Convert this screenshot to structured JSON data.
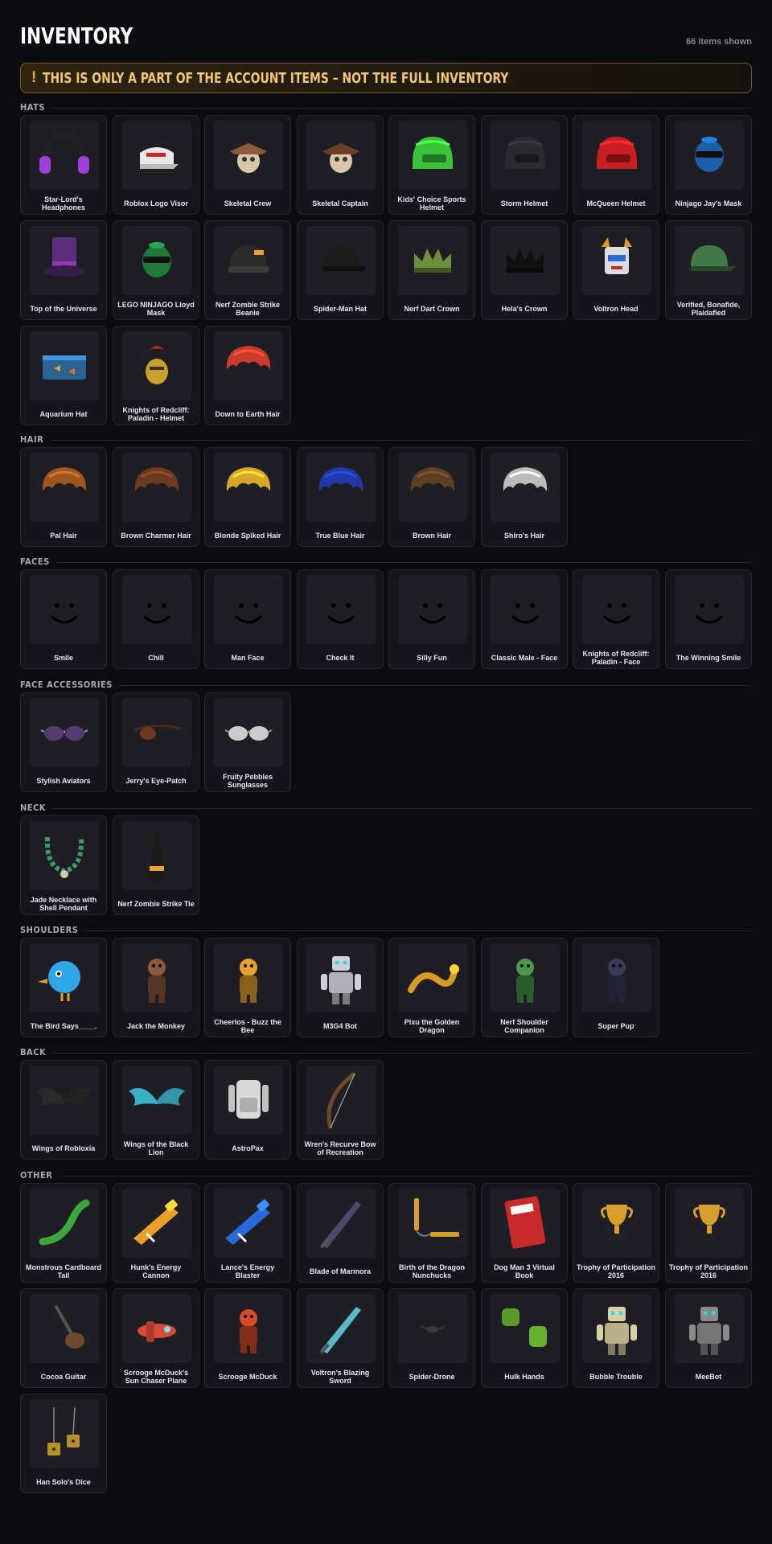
{
  "header": {
    "title": "INVENTORY",
    "count": "66 items shown"
  },
  "warning": {
    "icon": "!",
    "text": "THIS IS ONLY A PART OF THE ACCOUNT ITEMS – NOT THE FULL INVENTORY"
  },
  "colors": {
    "accent": "#f0a92e",
    "warning_text": "#f3c575",
    "background": "#0b0b10",
    "card": "#15151b"
  },
  "sections": [
    {
      "label": "HATS",
      "items": [
        {
          "name": "Star-Lord's Headphones",
          "icon": "headphones-icon",
          "color": "#9b3fd6"
        },
        {
          "name": "Roblox Logo Visor",
          "icon": "visor-icon",
          "color": "#e8e8e8"
        },
        {
          "name": "Skeletal Crew",
          "icon": "skull-hat-icon",
          "color": "#8a5a3a"
        },
        {
          "name": "Skeletal Captain",
          "icon": "skull-hat-icon",
          "color": "#6b3f25"
        },
        {
          "name": "Kids' Choice Sports Helmet",
          "icon": "helmet-icon",
          "color": "#39c23a"
        },
        {
          "name": "Storm Helmet",
          "icon": "helmet-icon",
          "color": "#2a2a30"
        },
        {
          "name": "McQueen Helmet",
          "icon": "helmet-icon",
          "color": "#c81e22"
        },
        {
          "name": "Ninjago Jay's Mask",
          "icon": "mask-icon",
          "color": "#1d5ea8"
        },
        {
          "name": "Top of the Universe",
          "icon": "top-hat-icon",
          "color": "#5a2e7a"
        },
        {
          "name": "LEGO NINJAGO Lloyd Mask",
          "icon": "mask-icon",
          "color": "#1f7a3a"
        },
        {
          "name": "Nerf Zombie Strike Beanie",
          "icon": "beanie-icon",
          "color": "#2a2a2a"
        },
        {
          "name": "Spider-Man Hat",
          "icon": "cap-icon",
          "color": "#1c1c1c"
        },
        {
          "name": "Nerf Dart Crown",
          "icon": "crown-icon",
          "color": "#6b8f3a"
        },
        {
          "name": "Hela's Crown",
          "icon": "crown-icon",
          "color": "#111111"
        },
        {
          "name": "Voltron Head",
          "icon": "robot-head-icon",
          "color": "#dddddd"
        },
        {
          "name": "Verified, Bonafide, Plaidafied",
          "icon": "cap-icon",
          "color": "#3f7a48"
        },
        {
          "name": "Aquarium Hat",
          "icon": "aquarium-icon",
          "color": "#2d6fa5"
        },
        {
          "name": "Knights of Redcliff: Paladin - Helmet",
          "icon": "knight-helmet-icon",
          "color": "#b12a22"
        },
        {
          "name": "Down to Earth Hair",
          "icon": "hair-icon",
          "color": "#c93b2b"
        }
      ]
    },
    {
      "label": "HAIR",
      "items": [
        {
          "name": "Pal Hair",
          "icon": "hair-icon",
          "color": "#a0561f"
        },
        {
          "name": "Brown Charmer Hair",
          "icon": "hair-icon",
          "color": "#6b3a1f"
        },
        {
          "name": "Blonde Spiked Hair",
          "icon": "hair-icon",
          "color": "#d6a82a"
        },
        {
          "name": "True Blue Hair",
          "icon": "hair-icon",
          "color": "#1f3aa6"
        },
        {
          "name": "Brown Hair",
          "icon": "hair-icon",
          "color": "#5e3e24"
        },
        {
          "name": "Shiro's Hair",
          "icon": "hair-icon",
          "color": "#bbbbbb"
        }
      ]
    },
    {
      "label": "FACES",
      "items": [
        {
          "name": "Smile",
          "icon": "face-icon",
          "color": "#111111"
        },
        {
          "name": "Chill",
          "icon": "face-icon",
          "color": "#111111"
        },
        {
          "name": "Man Face",
          "icon": "face-icon",
          "color": "#111111"
        },
        {
          "name": "Check It",
          "icon": "face-icon",
          "color": "#111111"
        },
        {
          "name": "Silly Fun",
          "icon": "face-icon",
          "color": "#111111"
        },
        {
          "name": "Classic Male - Face",
          "icon": "face-icon",
          "color": "#111111"
        },
        {
          "name": "Knights of Redcliff: Paladin - Face",
          "icon": "face-icon",
          "color": "#111111"
        },
        {
          "name": "The Winning Smile",
          "icon": "face-icon",
          "color": "#111111"
        }
      ]
    },
    {
      "label": "FACE ACCESSORIES",
      "items": [
        {
          "name": "Stylish Aviators",
          "icon": "glasses-icon",
          "color": "#5a3a6e"
        },
        {
          "name": "Jerry's Eye-Patch",
          "icon": "eye-patch-icon",
          "color": "#6b3a1f"
        },
        {
          "name": "Fruity Pebbles Sunglasses",
          "icon": "glasses-icon",
          "color": "#cccccc"
        }
      ]
    },
    {
      "label": "NECK",
      "items": [
        {
          "name": "Jade Necklace with Shell Pendant",
          "icon": "necklace-icon",
          "color": "#3a9a6a"
        },
        {
          "name": "Nerf Zombie Strike Tie",
          "icon": "tie-icon",
          "color": "#1a1a1a"
        }
      ]
    },
    {
      "label": "SHOULDERS",
      "items": [
        {
          "name": "The Bird Says____.",
          "icon": "bird-icon",
          "color": "#2ea6e8"
        },
        {
          "name": "Jack the Monkey",
          "icon": "monkey-icon",
          "color": "#8a5a3a"
        },
        {
          "name": "Cheerios - Buzz the Bee",
          "icon": "bee-icon",
          "color": "#e8a12a"
        },
        {
          "name": "M3G4 Bot",
          "icon": "robot-icon",
          "color": "#cfcfd6"
        },
        {
          "name": "Pixu the Golden Dragon",
          "icon": "dragon-icon",
          "color": "#d69a2a"
        },
        {
          "name": "Nerf Shoulder Companion",
          "icon": "zombie-icon",
          "color": "#4a9a4a"
        },
        {
          "name": "Super Pup",
          "icon": "dog-icon",
          "color": "#3a3a5a"
        }
      ]
    },
    {
      "label": "BACK",
      "items": [
        {
          "name": "Wings of Robloxia",
          "icon": "wings-icon",
          "color": "#2a2a2a"
        },
        {
          "name": "Wings of the Black Lion",
          "icon": "wings-icon",
          "color": "#3ab0c8"
        },
        {
          "name": "AstroPax",
          "icon": "backpack-icon",
          "color": "#d8d8d8"
        },
        {
          "name": "Wren's Recurve Bow of Recreation",
          "icon": "bow-icon",
          "color": "#6b4a2a"
        }
      ]
    },
    {
      "label": "OTHER",
      "items": [
        {
          "name": "Monstrous Cardboard Tail",
          "icon": "tail-icon",
          "color": "#3aa83a"
        },
        {
          "name": "Hunk's Energy Cannon",
          "icon": "cannon-icon",
          "color": "#e8a02a"
        },
        {
          "name": "Lance's Energy Blaster",
          "icon": "blaster-icon",
          "color": "#2a6ad8"
        },
        {
          "name": "Blade of Marmora",
          "icon": "blade-icon",
          "color": "#4a4a6e"
        },
        {
          "name": "Birth of the Dragon Nunchucks",
          "icon": "nunchucks-icon",
          "color": "#d8a02a"
        },
        {
          "name": "Dog Man 3 Virtual Book",
          "icon": "book-icon",
          "color": "#c82a2a"
        },
        {
          "name": "Trophy of Participation 2016",
          "icon": "trophy-icon",
          "color": "#d8a02a"
        },
        {
          "name": "Trophy of Participation 2016",
          "icon": "trophy-icon",
          "color": "#d8a02a"
        },
        {
          "name": "Cocoa Guitar",
          "icon": "guitar-icon",
          "color": "#6b4a2a"
        },
        {
          "name": "Scrooge McDuck's Sun Chaser Plane",
          "icon": "plane-icon",
          "color": "#d84a3a"
        },
        {
          "name": "Scrooge McDuck",
          "icon": "duck-icon",
          "color": "#d84a2a"
        },
        {
          "name": "Voltron's Blazing Sword",
          "icon": "sword-icon",
          "color": "#5ab8c8"
        },
        {
          "name": "Spider-Drone",
          "icon": "drone-icon",
          "color": "#3a3a3a"
        },
        {
          "name": "Hulk Hands",
          "icon": "hands-icon",
          "color": "#5a9a2a"
        },
        {
          "name": "Bubble Trouble",
          "icon": "robot-icon",
          "color": "#d8d0a0"
        },
        {
          "name": "MeeBot",
          "icon": "robot-icon",
          "color": "#8a8a8a"
        },
        {
          "name": "Han Solo's Dice",
          "icon": "dice-icon",
          "color": "#b8902a"
        }
      ]
    }
  ]
}
